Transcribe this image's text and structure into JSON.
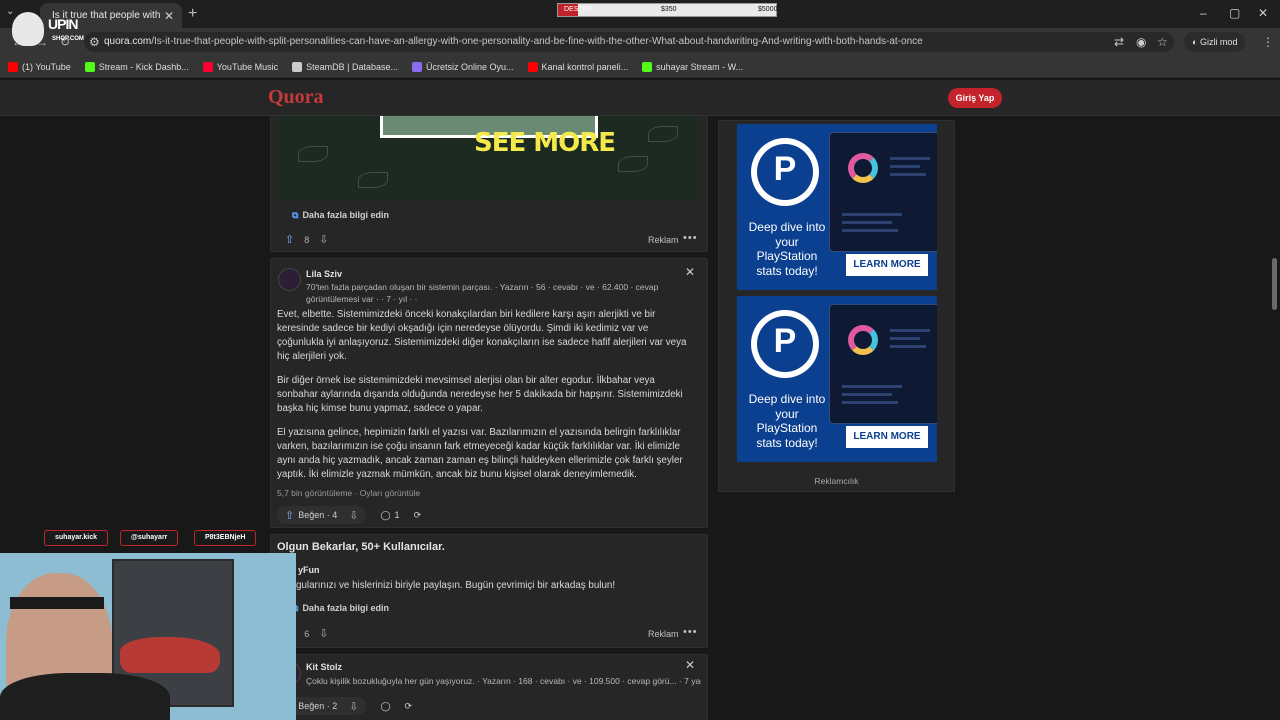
{
  "browser": {
    "tab_title": "Is it true that people with split p",
    "url_host": "quora.com",
    "url_path": "/Is-it-true-that-people-with-split-personalities-can-have-an-allergy-with-one-personality-and-be-fine-with-the-other-What-about-handwriting-And-writing-with-both-hands-at-once",
    "incognito_label": "Gizli mod",
    "bookmarks": [
      {
        "label": "(1) YouTube",
        "color": "#ff0000"
      },
      {
        "label": "Stream - Kick Dashb...",
        "color": "#53fc18"
      },
      {
        "label": "YouTube Music",
        "color": "#ff0033"
      },
      {
        "label": "SteamDB | Database...",
        "color": "#cccccc"
      },
      {
        "label": "Ücretsiz Online Oyu...",
        "color": "#8a6cf0"
      },
      {
        "label": "Kanal kontrol paneli...",
        "color": "#ff0000"
      },
      {
        "label": "suhayar Stream - W...",
        "color": "#53fc18"
      }
    ]
  },
  "donation": {
    "label": "DESTEK",
    "current": "$350",
    "goal": "$5000",
    "progress": 0.07
  },
  "quora": {
    "logo": "Quora",
    "login": "Giriş Yap"
  },
  "ad1": {
    "see_more": "SEE MORE",
    "learn_more": "Daha fazla bilgi edin",
    "upvotes": "8",
    "sponsored": "Reklam"
  },
  "answer1": {
    "author": "Lila Sziv",
    "cred_line1": "70'ten fazla parçadan oluşan bir sistemin parçası. · Yazarın · 56 · cevabı · ve · 62.400 · cevap",
    "cred_line2": "görüntülemesi var · · 7 · yıl · ·",
    "p1": "Evet, elbette. Sistemimizdeki önceki konakçılardan biri kedilere karşı aşırı alerjikti ve bir keresinde sadece bir kediyi okşadığı için neredeyse ölüyordu. Şimdi iki kedimiz var ve çoğunlukla iyi anlaşıyoruz. Sistemimizdeki diğer konakçıların ise sadece hafif alerjileri var veya hiç alerjileri yok.",
    "p2": "Bir diğer örnek ise sistemimizdeki mevsimsel alerjisi olan bir alter egodur. İlkbahar veya sonbahar aylarında dışarıda olduğunda neredeyse her 5 dakikada bir hapşırır. Sistemimizdeki başka hiç kimse bunu yapmaz, sadece o yapar.",
    "p3": "El yazısına gelince, hepimizin farklı el yazısı var. Bazılarımızın el yazısında belirgin farklılıklar varken, bazılarımızın ise çoğu insanın fark etmeyeceği kadar küçük farklılıklar var. İki elimizle aynı anda hiç yazmadık, ancak zaman zaman eş bilinçli haldeyken ellerimizle çok farklı şeyler yaptık. İki elimizle yazmak mümkün, ancak biz bunu kişisel olarak deneyimlemedik.",
    "meta": "5,7 bin görüntüleme · Oyları görüntüle",
    "like": "Beğen · 4",
    "comments": "1"
  },
  "ad2": {
    "title": "Olgun Bekarlar, 50+ Kullanıcılar.",
    "advertiser": "yFun",
    "text": "gularınızı ve hislerinizi biriyle paylaşın. Bugün çevrimiçi bir arkadaş bulun!",
    "learn_more": "Daha fazla bilgi edin",
    "upvotes": "6",
    "sponsored": "Reklam"
  },
  "answer2": {
    "author": "Kit Stolz",
    "cred": "Çoklu kişilik bozukluğuyla her gün yaşıyoruz. · Yazarın · 168 · cevabı · ve · 109.500 · cevap görü... · 7 yaş",
    "like": "Beğen · 2"
  },
  "sidebar": {
    "ads": [
      {
        "text": "Deep dive into your PlayStation stats today!",
        "button": "LEARN MORE"
      },
      {
        "text": "Deep dive into your PlayStation stats today!",
        "button": "LEARN MORE"
      }
    ],
    "advertiser_label": "Reklamcılık"
  },
  "overlay": {
    "logo_top": "UPIN",
    "logo_bottom": "SHOP.COM",
    "socials": [
      "suhayar.kick",
      "@suhayarr",
      "P8t3EBNjeH"
    ]
  }
}
